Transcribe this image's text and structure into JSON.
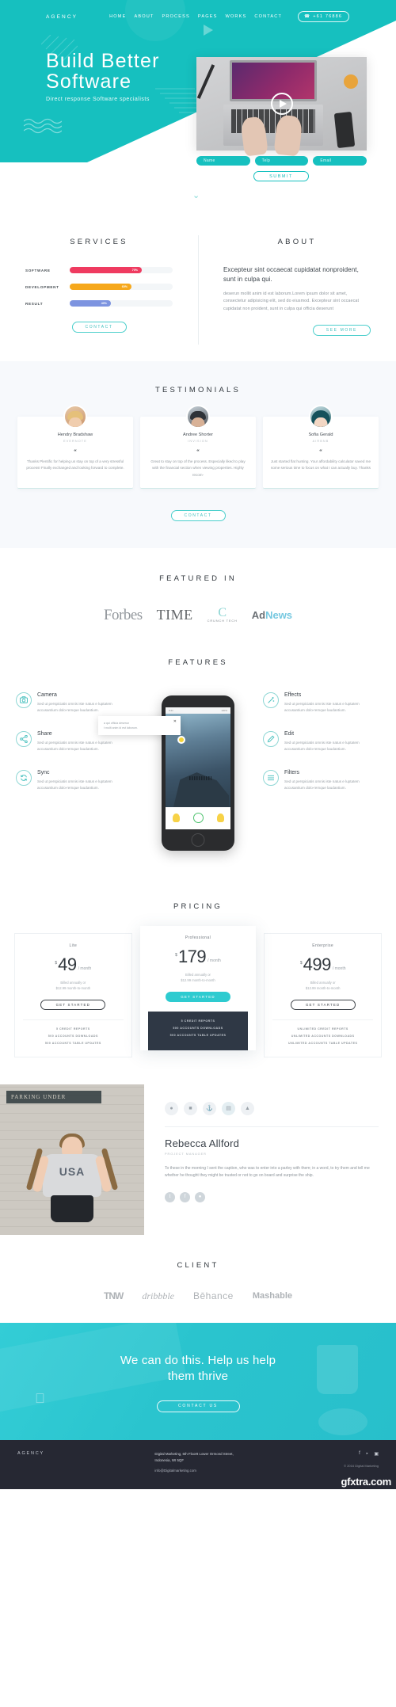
{
  "hero": {
    "brand": "AGENCY",
    "nav": [
      "HOME",
      "ABOUT",
      "PROCESS",
      "PAGES",
      "WORKS",
      "CONTACT"
    ],
    "phone": "+61 76886",
    "title_line1": "Build Better",
    "title_line2": "Software",
    "subtitle": "Direct response Software specialists",
    "form": {
      "name_placeholder": "Name",
      "telp_placeholder": "Telp",
      "email_placeholder": "Email",
      "submit_label": "SUBMIT"
    },
    "accent": "#16c0bf"
  },
  "services": {
    "heading": "SERVICES",
    "skills": [
      {
        "label": "SOFTWARE",
        "value": 70,
        "display": "70%",
        "color": "#ef3b60"
      },
      {
        "label": "DEVELOPMENT",
        "value": 60,
        "display": "60%",
        "color": "#f6a81c"
      },
      {
        "label": "RESULT",
        "value": 40,
        "display": "40%",
        "color": "#7d94e0"
      }
    ],
    "button": "CONTACT"
  },
  "about": {
    "heading": "ABOUT",
    "lead": "Excepteur sint occaecat cupidatat nonproident, sunt in culpa qui.",
    "body": "deserun mollit anim id est laborum.Lorem ipsum dolor sit amet, consectetur adipisicing elit, sed do eiusmod. Excepteur sint occaecat cupidatat non proident, sunt in culpa qui officia deserunt",
    "button": "SEE MORE"
  },
  "testimonials": {
    "heading": "TESTIMONIALS",
    "button": "CONTACT",
    "quote_mark": "“",
    "items": [
      {
        "name": "Hendry Bradshaw",
        "company": "EVERNOTE",
        "text": "Thanks Plentific for helping us stay on top of a very stressful process! Finally exchanged and looking forward to complete."
      },
      {
        "name": "Andree Shorter",
        "company": "INVISION",
        "text": "Great to stay on top of the process. Especially liked to play with the financial section when viewing properties. Highly recom-"
      },
      {
        "name": "Sofia Gerald",
        "company": "AIRBNB",
        "text": "Just started flat hunting. Your affordability calculator saved me some serious time to focus on what I can actually buy. Thanks"
      }
    ]
  },
  "featured": {
    "heading_hl": "FEATURED",
    "heading_rest": " IN",
    "logos": [
      "Forbes",
      "TIME",
      "CRUNCH TECH",
      "AdNews"
    ]
  },
  "features": {
    "heading": "FEATURES",
    "body": "Sed ut perspiciatis omnis iste natus e luptatem accusantium dolo-remque laudantium.",
    "left": [
      {
        "title": "Camera",
        "icon": "camera-icon"
      },
      {
        "title": "Share",
        "icon": "share-icon"
      },
      {
        "title": "Sync",
        "icon": "sync-icon"
      }
    ],
    "right": [
      {
        "title": "Effects",
        "icon": "wand-icon"
      },
      {
        "title": "Edit",
        "icon": "pencil-icon"
      },
      {
        "title": "Filters",
        "icon": "filters-icon"
      }
    ],
    "tooltip_line1": "a qui officia deserun",
    "tooltip_line2": "t mollt anim id est laborum.",
    "phone_status_time": "9:41",
    "phone_status_batt": "100%"
  },
  "pricing": {
    "heading": "PRICING",
    "currency": "$",
    "per": "/ month",
    "plans": [
      {
        "name": "Lite",
        "price": "49",
        "note_l1": "Billed annually or",
        "note_l2": "$12.99 month-to-month",
        "cta": "GET STARTED",
        "featured": false,
        "features": [
          "5 CREDIT REPORTS",
          "500 ACCOUNTS DOWNLOADS",
          "500 ACCOUNTS TABLE UPDATES"
        ]
      },
      {
        "name": "Professional",
        "price": "179",
        "note_l1": "Billed annually or",
        "note_l2": "$12.99 month-to-month",
        "cta": "GET STARTED",
        "featured": true,
        "features": [
          "5 CREDIT REPORTS",
          "500 ACCOUNTS DOWNLOADS",
          "500 ACCOUNTS TABLE UPDATES"
        ]
      },
      {
        "name": "Enterprise",
        "price": "499",
        "note_l1": "Billed annually or",
        "note_l2": "$12.99 month-to-month",
        "cta": "GET STARTED",
        "featured": false,
        "features": [
          "UNLIMITED CREDIT REPORTS",
          "UNLIMITED ACCOUNTS DOWNLOADS",
          "UNLIMITED ACCOUNTS TABLE UPDATES"
        ]
      }
    ]
  },
  "profile": {
    "sign_text": "PARKING UNDER",
    "shirt_text": "USA",
    "name": "Rebecca Allford",
    "role": "PROJECT MANAGER",
    "text": "To these in the morning I sent the caption, who was to enter into a parley with them; in a word, to try them and tell me whether he thought they might be trusted or not to go on board and surprise the ship.",
    "icons": [
      "user-icon",
      "briefcase-icon",
      "anchor-icon",
      "book-icon",
      "chart-icon"
    ],
    "social": [
      "twitter-icon",
      "facebook-icon",
      "dribbble-icon"
    ]
  },
  "client": {
    "heading": "CLIENT",
    "logos": [
      "TNW",
      "dribbble",
      "Bēhance",
      "Mashable"
    ]
  },
  "cta": {
    "line1": "We can do this. Help us help",
    "line2": "them thrive",
    "button": "CONTACT US"
  },
  "footer": {
    "brand": "AGENCY",
    "address_line1": "Digital Marketing, 6th Floor8 Lower Ormond Street,",
    "address_line2": "Indonesia, WI 5QF",
    "email": "info@Digitalmarketing.com",
    "copyright": "© 2016 Digital Marketing",
    "social": [
      "facebook-icon",
      "twitter-icon",
      "instagram-icon"
    ],
    "watermark": "gfxtra.com"
  }
}
